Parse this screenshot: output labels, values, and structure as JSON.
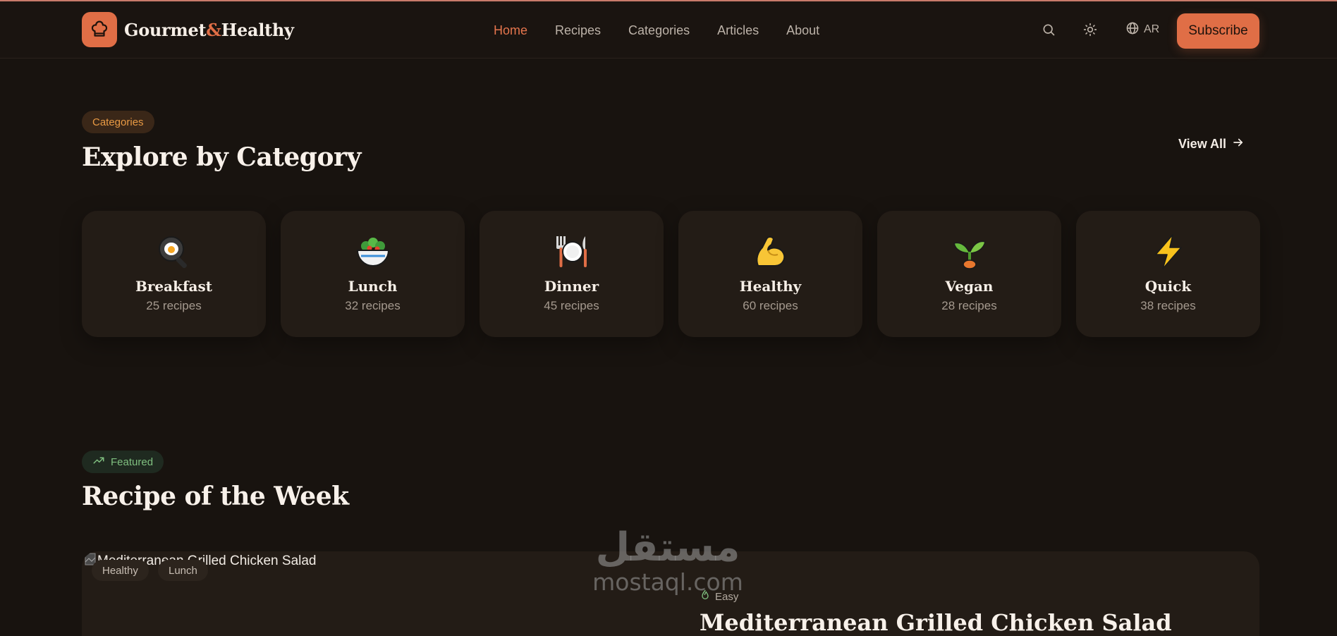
{
  "brand": {
    "name_part1": "Gourmet",
    "name_amp": "&",
    "name_part2": "Healthy",
    "logo_icon": "chef-hat-icon",
    "accent_color": "#e06e46"
  },
  "nav": {
    "items": [
      {
        "label": "Home",
        "active": true
      },
      {
        "label": "Recipes",
        "active": false
      },
      {
        "label": "Categories",
        "active": false
      },
      {
        "label": "Articles",
        "active": false
      },
      {
        "label": "About",
        "active": false
      }
    ]
  },
  "header_actions": {
    "search_icon": "search-icon",
    "theme_icon": "sun-icon",
    "language_icon": "globe-icon",
    "language_label": "AR",
    "subscribe_label": "Subscribe"
  },
  "categories_section": {
    "badge": "Categories",
    "title": "Explore by Category",
    "view_all": "View All",
    "items": [
      {
        "icon": "frying-pan-egg-icon",
        "name": "Breakfast",
        "count": "25 recipes"
      },
      {
        "icon": "salad-bowl-icon",
        "name": "Lunch",
        "count": "32 recipes"
      },
      {
        "icon": "plate-fork-knife-icon",
        "name": "Dinner",
        "count": "45 recipes"
      },
      {
        "icon": "flexed-biceps-icon",
        "name": "Healthy",
        "count": "60 recipes"
      },
      {
        "icon": "seedling-icon",
        "name": "Vegan",
        "count": "28 recipes"
      },
      {
        "icon": "lightning-icon",
        "name": "Quick",
        "count": "38 recipes"
      }
    ]
  },
  "featured_section": {
    "badge": "Featured",
    "title": "Recipe of the Week",
    "recipe": {
      "image_alt": "Mediterranean Grilled Chicken Salad",
      "tags": [
        "Healthy",
        "Lunch"
      ],
      "difficulty": "Easy",
      "title": "Mediterranean Grilled Chicken Salad"
    }
  },
  "watermark": {
    "arabic": "مستقل",
    "latin": "mostaql.com"
  }
}
